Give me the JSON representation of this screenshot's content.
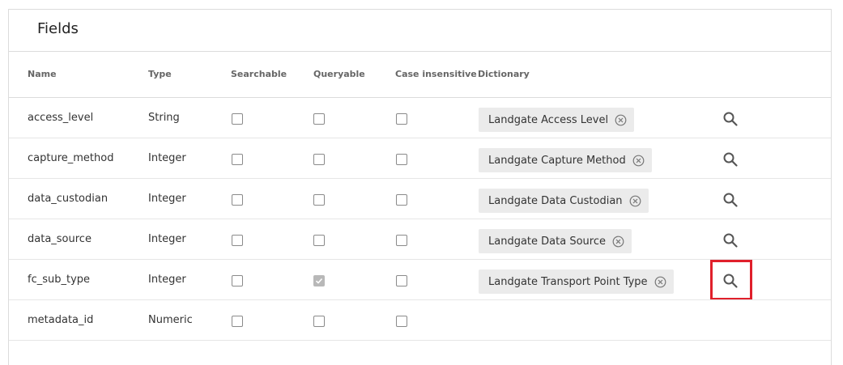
{
  "panel": {
    "title": "Fields"
  },
  "columns": {
    "name": "Name",
    "type": "Type",
    "searchable": "Searchable",
    "queryable": "Queryable",
    "case_insensitive": "Case insensitive",
    "dictionary": "Dictionary"
  },
  "rows": [
    {
      "name": "access_level",
      "type": "String",
      "searchable": false,
      "queryable": false,
      "case_insensitive": false,
      "dictionary": "Landgate Access Level",
      "has_lookup": true
    },
    {
      "name": "capture_method",
      "type": "Integer",
      "searchable": false,
      "queryable": false,
      "case_insensitive": false,
      "dictionary": "Landgate Capture Method",
      "has_lookup": true
    },
    {
      "name": "data_custodian",
      "type": "Integer",
      "searchable": false,
      "queryable": false,
      "case_insensitive": false,
      "dictionary": "Landgate Data Custodian",
      "has_lookup": true
    },
    {
      "name": "data_source",
      "type": "Integer",
      "searchable": false,
      "queryable": false,
      "case_insensitive": false,
      "dictionary": "Landgate Data Source",
      "has_lookup": true
    },
    {
      "name": "fc_sub_type",
      "type": "Integer",
      "searchable": false,
      "queryable": true,
      "case_insensitive": false,
      "dictionary": "Landgate Transport Point Type",
      "has_lookup": true,
      "highlighted": true
    },
    {
      "name": "metadata_id",
      "type": "Numeric",
      "searchable": false,
      "queryable": false,
      "case_insensitive": false,
      "dictionary": "",
      "has_lookup": false
    }
  ],
  "icons": {
    "lookup": "search-icon",
    "remove": "close-circle-icon"
  },
  "colors": {
    "highlight": "#e0202b",
    "chip_bg": "#ebebeb",
    "checked_box": "#b8b8b8"
  }
}
